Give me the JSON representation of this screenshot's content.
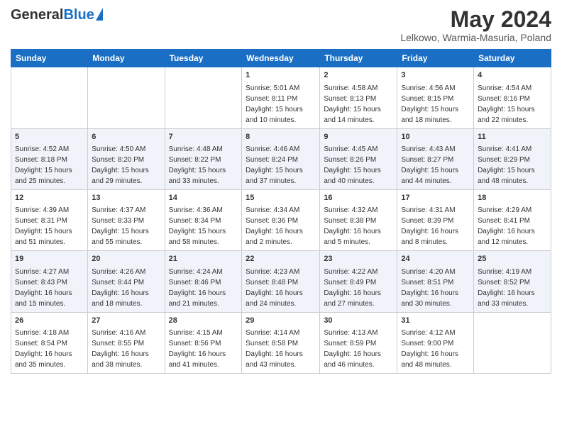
{
  "logo": {
    "general": "General",
    "blue": "Blue"
  },
  "title": "May 2024",
  "subtitle": "Lelkowo, Warmia-Masuria, Poland",
  "days_of_week": [
    "Sunday",
    "Monday",
    "Tuesday",
    "Wednesday",
    "Thursday",
    "Friday",
    "Saturday"
  ],
  "weeks": [
    [
      {
        "day": "",
        "sunrise": "",
        "sunset": "",
        "daylight": ""
      },
      {
        "day": "",
        "sunrise": "",
        "sunset": "",
        "daylight": ""
      },
      {
        "day": "",
        "sunrise": "",
        "sunset": "",
        "daylight": ""
      },
      {
        "day": "1",
        "sunrise": "Sunrise: 5:01 AM",
        "sunset": "Sunset: 8:11 PM",
        "daylight": "Daylight: 15 hours and 10 minutes."
      },
      {
        "day": "2",
        "sunrise": "Sunrise: 4:58 AM",
        "sunset": "Sunset: 8:13 PM",
        "daylight": "Daylight: 15 hours and 14 minutes."
      },
      {
        "day": "3",
        "sunrise": "Sunrise: 4:56 AM",
        "sunset": "Sunset: 8:15 PM",
        "daylight": "Daylight: 15 hours and 18 minutes."
      },
      {
        "day": "4",
        "sunrise": "Sunrise: 4:54 AM",
        "sunset": "Sunset: 8:16 PM",
        "daylight": "Daylight: 15 hours and 22 minutes."
      }
    ],
    [
      {
        "day": "5",
        "sunrise": "Sunrise: 4:52 AM",
        "sunset": "Sunset: 8:18 PM",
        "daylight": "Daylight: 15 hours and 25 minutes."
      },
      {
        "day": "6",
        "sunrise": "Sunrise: 4:50 AM",
        "sunset": "Sunset: 8:20 PM",
        "daylight": "Daylight: 15 hours and 29 minutes."
      },
      {
        "day": "7",
        "sunrise": "Sunrise: 4:48 AM",
        "sunset": "Sunset: 8:22 PM",
        "daylight": "Daylight: 15 hours and 33 minutes."
      },
      {
        "day": "8",
        "sunrise": "Sunrise: 4:46 AM",
        "sunset": "Sunset: 8:24 PM",
        "daylight": "Daylight: 15 hours and 37 minutes."
      },
      {
        "day": "9",
        "sunrise": "Sunrise: 4:45 AM",
        "sunset": "Sunset: 8:26 PM",
        "daylight": "Daylight: 15 hours and 40 minutes."
      },
      {
        "day": "10",
        "sunrise": "Sunrise: 4:43 AM",
        "sunset": "Sunset: 8:27 PM",
        "daylight": "Daylight: 15 hours and 44 minutes."
      },
      {
        "day": "11",
        "sunrise": "Sunrise: 4:41 AM",
        "sunset": "Sunset: 8:29 PM",
        "daylight": "Daylight: 15 hours and 48 minutes."
      }
    ],
    [
      {
        "day": "12",
        "sunrise": "Sunrise: 4:39 AM",
        "sunset": "Sunset: 8:31 PM",
        "daylight": "Daylight: 15 hours and 51 minutes."
      },
      {
        "day": "13",
        "sunrise": "Sunrise: 4:37 AM",
        "sunset": "Sunset: 8:33 PM",
        "daylight": "Daylight: 15 hours and 55 minutes."
      },
      {
        "day": "14",
        "sunrise": "Sunrise: 4:36 AM",
        "sunset": "Sunset: 8:34 PM",
        "daylight": "Daylight: 15 hours and 58 minutes."
      },
      {
        "day": "15",
        "sunrise": "Sunrise: 4:34 AM",
        "sunset": "Sunset: 8:36 PM",
        "daylight": "Daylight: 16 hours and 2 minutes."
      },
      {
        "day": "16",
        "sunrise": "Sunrise: 4:32 AM",
        "sunset": "Sunset: 8:38 PM",
        "daylight": "Daylight: 16 hours and 5 minutes."
      },
      {
        "day": "17",
        "sunrise": "Sunrise: 4:31 AM",
        "sunset": "Sunset: 8:39 PM",
        "daylight": "Daylight: 16 hours and 8 minutes."
      },
      {
        "day": "18",
        "sunrise": "Sunrise: 4:29 AM",
        "sunset": "Sunset: 8:41 PM",
        "daylight": "Daylight: 16 hours and 12 minutes."
      }
    ],
    [
      {
        "day": "19",
        "sunrise": "Sunrise: 4:27 AM",
        "sunset": "Sunset: 8:43 PM",
        "daylight": "Daylight: 16 hours and 15 minutes."
      },
      {
        "day": "20",
        "sunrise": "Sunrise: 4:26 AM",
        "sunset": "Sunset: 8:44 PM",
        "daylight": "Daylight: 16 hours and 18 minutes."
      },
      {
        "day": "21",
        "sunrise": "Sunrise: 4:24 AM",
        "sunset": "Sunset: 8:46 PM",
        "daylight": "Daylight: 16 hours and 21 minutes."
      },
      {
        "day": "22",
        "sunrise": "Sunrise: 4:23 AM",
        "sunset": "Sunset: 8:48 PM",
        "daylight": "Daylight: 16 hours and 24 minutes."
      },
      {
        "day": "23",
        "sunrise": "Sunrise: 4:22 AM",
        "sunset": "Sunset: 8:49 PM",
        "daylight": "Daylight: 16 hours and 27 minutes."
      },
      {
        "day": "24",
        "sunrise": "Sunrise: 4:20 AM",
        "sunset": "Sunset: 8:51 PM",
        "daylight": "Daylight: 16 hours and 30 minutes."
      },
      {
        "day": "25",
        "sunrise": "Sunrise: 4:19 AM",
        "sunset": "Sunset: 8:52 PM",
        "daylight": "Daylight: 16 hours and 33 minutes."
      }
    ],
    [
      {
        "day": "26",
        "sunrise": "Sunrise: 4:18 AM",
        "sunset": "Sunset: 8:54 PM",
        "daylight": "Daylight: 16 hours and 35 minutes."
      },
      {
        "day": "27",
        "sunrise": "Sunrise: 4:16 AM",
        "sunset": "Sunset: 8:55 PM",
        "daylight": "Daylight: 16 hours and 38 minutes."
      },
      {
        "day": "28",
        "sunrise": "Sunrise: 4:15 AM",
        "sunset": "Sunset: 8:56 PM",
        "daylight": "Daylight: 16 hours and 41 minutes."
      },
      {
        "day": "29",
        "sunrise": "Sunrise: 4:14 AM",
        "sunset": "Sunset: 8:58 PM",
        "daylight": "Daylight: 16 hours and 43 minutes."
      },
      {
        "day": "30",
        "sunrise": "Sunrise: 4:13 AM",
        "sunset": "Sunset: 8:59 PM",
        "daylight": "Daylight: 16 hours and 46 minutes."
      },
      {
        "day": "31",
        "sunrise": "Sunrise: 4:12 AM",
        "sunset": "Sunset: 9:00 PM",
        "daylight": "Daylight: 16 hours and 48 minutes."
      },
      {
        "day": "",
        "sunrise": "",
        "sunset": "",
        "daylight": ""
      }
    ]
  ]
}
